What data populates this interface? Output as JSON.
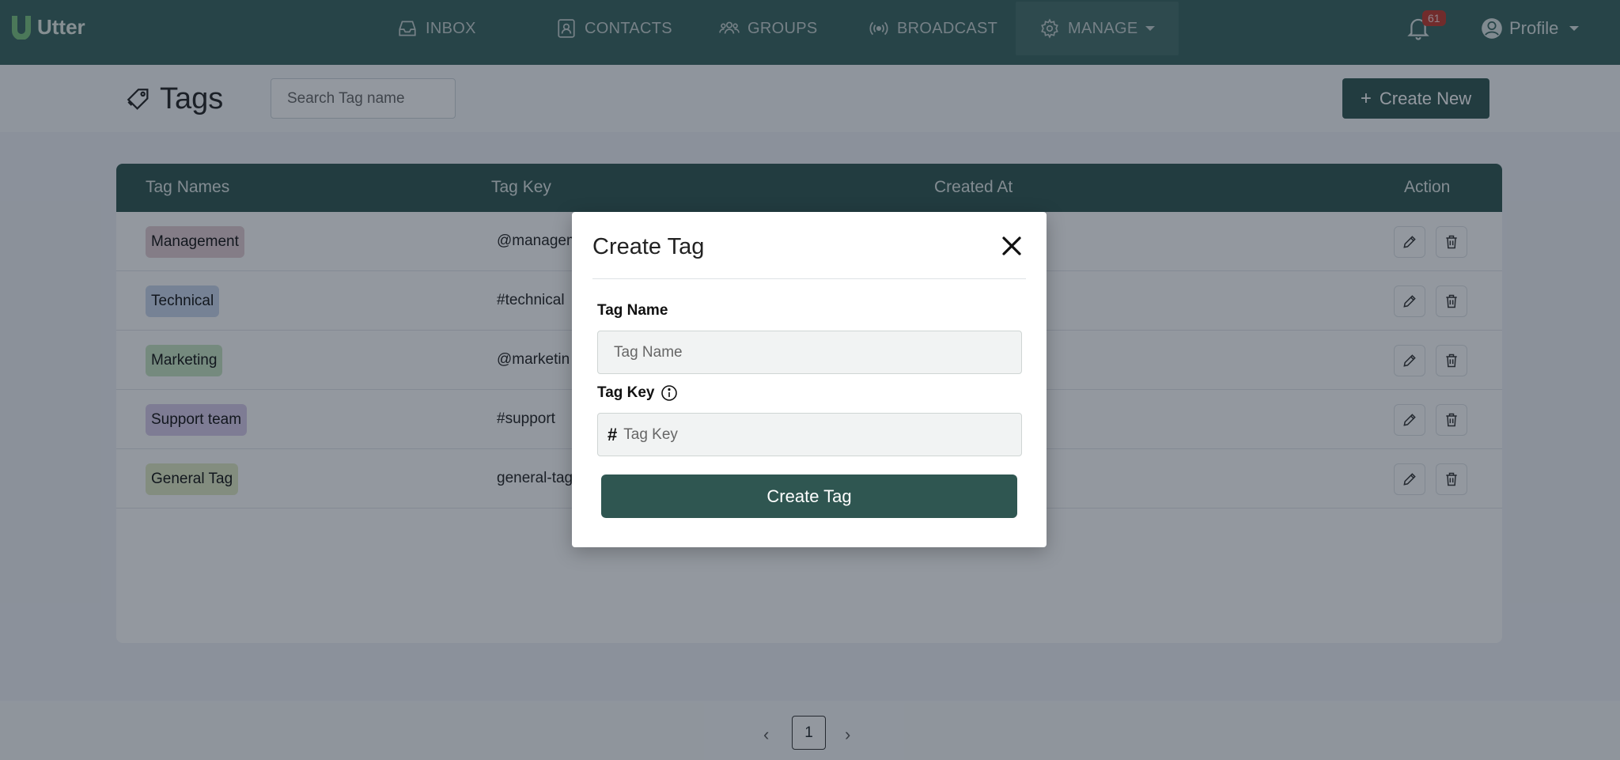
{
  "app": {
    "name": "Utter"
  },
  "nav": {
    "items": [
      {
        "label": "INBOX",
        "icon": "inbox-icon"
      },
      {
        "label": "CONTACTS",
        "icon": "contact-card-icon"
      },
      {
        "label": "GROUPS",
        "icon": "people-icon"
      },
      {
        "label": "BROADCAST",
        "icon": "broadcast-icon"
      },
      {
        "label": "MANAGE",
        "icon": "gear-icon",
        "active": true
      }
    ],
    "notifications_count": "61",
    "profile_label": "Profile"
  },
  "page": {
    "title": "Tags",
    "search_placeholder": "Search Tag name",
    "create_button": "Create New"
  },
  "table": {
    "headers": [
      "Tag Names",
      "Tag Key",
      "Created At",
      "Action"
    ],
    "rows": [
      {
        "name": "Management",
        "key": "@managem",
        "color": "#e3cdd2"
      },
      {
        "name": "Technical",
        "key": "#technical",
        "color": "#c9d6ec"
      },
      {
        "name": "Marketing",
        "key": "@marketin",
        "color": "#c8e6c3"
      },
      {
        "name": "Support team",
        "key": "#support",
        "color": "#d9ccea"
      },
      {
        "name": "General Tag",
        "key": "general-tag",
        "color": "#e2ebc4"
      }
    ]
  },
  "pagination": {
    "current": "1"
  },
  "modal": {
    "title": "Create Tag",
    "name_label": "Tag Name",
    "name_placeholder": "Tag Name",
    "key_label": "Tag Key",
    "key_prefix": "#",
    "key_placeholder": "Tag Key",
    "submit_label": "Create Tag"
  },
  "colors": {
    "primary": "#2f5651",
    "nav_bg": "#39655f",
    "badge": "#c0392b"
  }
}
